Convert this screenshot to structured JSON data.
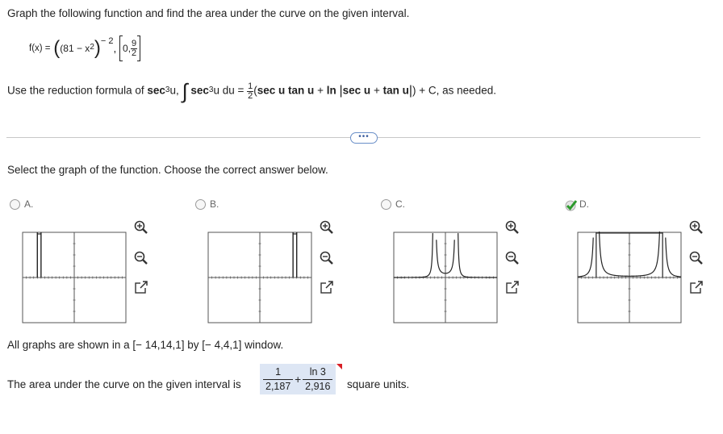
{
  "question": {
    "instruction": "Graph the following function and find the area under the curve on the given interval.",
    "function": {
      "lhs": "f(x) =",
      "base_open": "(81 − x",
      "base_exp": "2",
      "base_close": ")",
      "outer_exp": "− 2",
      "comma": ",",
      "interval_start": "0,",
      "interval_num": "9",
      "interval_den": "2"
    },
    "hint": {
      "prefix": "Use the reduction formula of",
      "sec": "sec",
      "cube": "3",
      "u_comma": "u,",
      "integrand_sec": "sec",
      "integrand_cube": "3",
      "integrand_rest": "u du =",
      "half_num": "1",
      "half_den": "2",
      "expr_open": "(",
      "sec_u_tan_u": "sec u tan u",
      "plus1": "+",
      "ln": "ln",
      "abs_inner_sec": "sec u",
      "plus2": "+",
      "abs_inner_tan": "tan u",
      "expr_close": ") + C, as needed."
    }
  },
  "more_button": "•••",
  "prompt": "Select the graph of the function. Choose the correct answer below.",
  "options": [
    {
      "label": "A.",
      "selected": false,
      "correct": false
    },
    {
      "label": "B.",
      "selected": false,
      "correct": false
    },
    {
      "label": "C.",
      "selected": false,
      "correct": false
    },
    {
      "label": "D.",
      "selected": true,
      "correct": true
    }
  ],
  "tools": [
    "zoom-in-icon",
    "zoom-out-icon",
    "pop-out-icon"
  ],
  "window_note": "All graphs are shown in a [− 14,14,1] by [− 4,4,1] window.",
  "area": {
    "prefix": "The area under the curve on the given interval is",
    "term1_num": "1",
    "term1_den": "2,187",
    "plus": "+",
    "term2_num": "ln 3",
    "term2_den": "2,916",
    "suffix": "square units."
  },
  "colors": {
    "accent": "#3d5f9f",
    "answer_bg": "#dde6f4",
    "correct_check": "#2e9a2e",
    "flag": "#d81f26"
  }
}
